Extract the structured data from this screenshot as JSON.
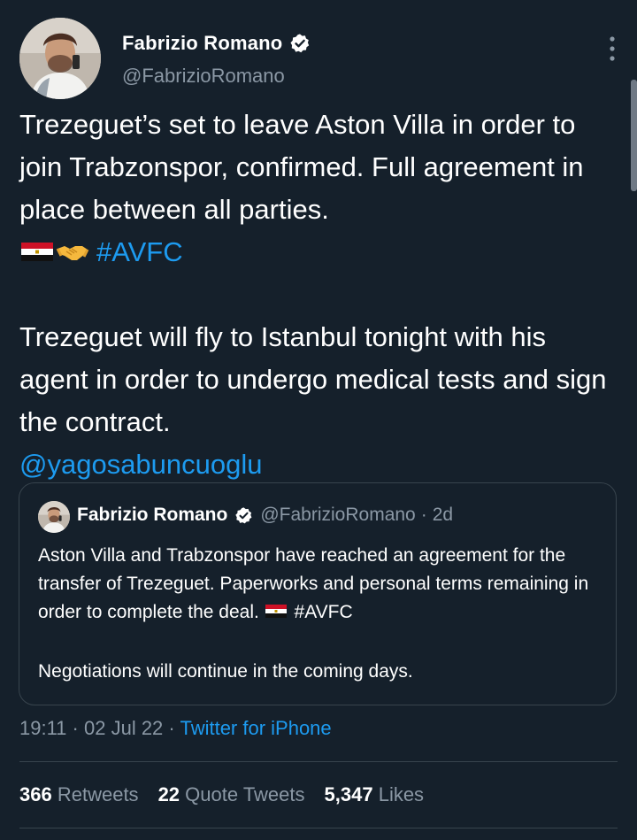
{
  "author": {
    "name": "Fabrizio Romano",
    "handle": "@FabrizioRomano",
    "avatar_icon": "profile-photo",
    "verified_icon": "verified-badge-icon"
  },
  "tweet": {
    "line1": "Trezeguet’s set to leave Aston Villa in order to join Trabzonspor, confirmed. Full agreement in place between all parties.",
    "emoji_flag": "egypt-flag",
    "emoji_handshake": "handshake",
    "hashtag": "#AVFC",
    "line2": "Trezeguet will fly to Istanbul tonight with his agent in order to undergo medical tests and sign the contract.",
    "mention": "@yagosabuncuoglu"
  },
  "quoted_tweet": {
    "name": "Fabrizio Romano",
    "handle": "@FabrizioRomano",
    "separator": "·",
    "age": "2d",
    "text1": "Aston Villa and Trabzonspor have reached an agreement for the transfer of Trezeguet. Paperworks and personal terms remaining in order to complete the deal.",
    "hashtag": "#AVFC",
    "text2": "Negotiations will continue in the coming days."
  },
  "meta": {
    "time": "19:11",
    "separator": "·",
    "date": "02 Jul 22",
    "source": "Twitter for iPhone"
  },
  "stats": {
    "retweets_count": "366",
    "retweets_label": "Retweets",
    "quotes_count": "22",
    "quotes_label": "Quote Tweets",
    "likes_count": "5,347",
    "likes_label": "Likes"
  },
  "colors": {
    "background": "#15202b",
    "text": "#ffffff",
    "secondary": "#8b98a5",
    "link": "#1d9bf0",
    "border": "#38444d"
  }
}
